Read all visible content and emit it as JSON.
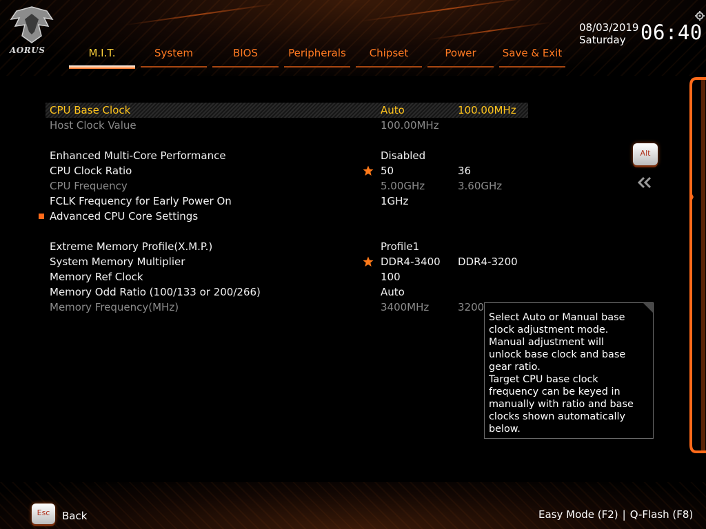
{
  "brand": {
    "logo_text": "AORUS",
    "accent_color": "#ff6a1a",
    "highlight_color": "#ffc41c"
  },
  "tabs": [
    {
      "label": "M.I.T.",
      "active": true
    },
    {
      "label": "System"
    },
    {
      "label": "BIOS"
    },
    {
      "label": "Peripherals"
    },
    {
      "label": "Chipset"
    },
    {
      "label": "Power"
    },
    {
      "label": "Save & Exit"
    }
  ],
  "header": {
    "date": "08/03/2019",
    "day": "Saturday",
    "time": "06:40",
    "settings_icon": "gear-icon"
  },
  "items": [
    {
      "name": "CPU Base Clock",
      "value": "Auto",
      "value2": "100.00MHz",
      "state": "selected"
    },
    {
      "name": "Host Clock Value",
      "value": "100.00MHz",
      "value2": "",
      "state": "dim"
    },
    {
      "name": "Enhanced Multi-Core Performance",
      "value": "Disabled",
      "value2": "",
      "state": "normal"
    },
    {
      "name": "CPU Clock Ratio",
      "value": "50",
      "value2": "36",
      "state": "normal",
      "star": true
    },
    {
      "name": "CPU Frequency",
      "value": "5.00GHz",
      "value2": "3.60GHz",
      "state": "dim"
    },
    {
      "name": "FCLK Frequency for Early Power On",
      "value": "1GHz",
      "value2": "",
      "state": "normal"
    },
    {
      "name": "Advanced CPU Core Settings",
      "value": "",
      "value2": "",
      "state": "normal",
      "submenu": true
    },
    {
      "name": "Extreme Memory Profile(X.M.P.)",
      "value": "Profile1",
      "value2": "",
      "state": "normal"
    },
    {
      "name": "System Memory Multiplier",
      "value": "DDR4-3400",
      "value2": "DDR4-3200",
      "state": "normal",
      "star": true
    },
    {
      "name": "Memory Ref Clock",
      "value": "100",
      "value2": "",
      "state": "normal"
    },
    {
      "name": "Memory Odd Ratio (100/133 or 200/266)",
      "value": "Auto",
      "value2": "",
      "state": "normal"
    },
    {
      "name": "Memory Frequency(MHz)",
      "value": "3400MHz",
      "value2": "3200",
      "state": "dim"
    }
  ],
  "side": {
    "alt_label": "Alt",
    "collapse_icon": "double-chevron-left-icon"
  },
  "help": {
    "lines": [
      "Select Auto or Manual base",
      "clock adjustment mode.",
      "Manual adjustment will",
      "unlock base clock and base",
      "gear ratio.",
      "Target CPU base clock",
      "frequency can be keyed in",
      "manually with ratio and base",
      "clocks shown automatically",
      "below."
    ]
  },
  "footer": {
    "esc_label": "Esc",
    "back_label": "Back",
    "easy_mode": "Easy Mode (F2)",
    "separator": "|",
    "qflash": "Q-Flash (F8)"
  }
}
